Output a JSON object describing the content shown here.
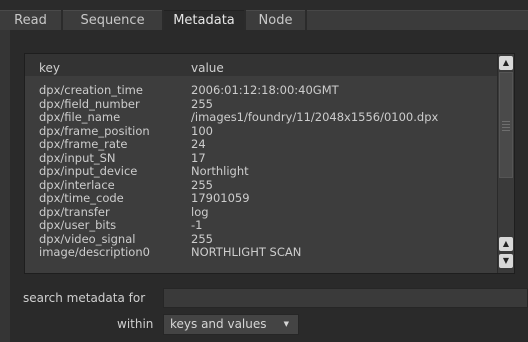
{
  "tabs": [
    {
      "label": "Read"
    },
    {
      "label": "Sequence"
    },
    {
      "label": "Metadata"
    },
    {
      "label": "Node"
    }
  ],
  "table": {
    "headers": {
      "key": "key",
      "value": "value"
    },
    "rows": [
      {
        "key": "dpx/creation_time",
        "value": "2006:01:12:18:00:40GMT"
      },
      {
        "key": "dpx/field_number",
        "value": "255"
      },
      {
        "key": "dpx/file_name",
        "value": "/images1/foundry/11/2048x1556/0100.dpx"
      },
      {
        "key": "dpx/frame_position",
        "value": "100"
      },
      {
        "key": "dpx/frame_rate",
        "value": "24"
      },
      {
        "key": "dpx/input_SN",
        "value": "17"
      },
      {
        "key": "dpx/input_device",
        "value": "Northlight"
      },
      {
        "key": "dpx/interlace",
        "value": "255"
      },
      {
        "key": "dpx/time_code",
        "value": "17901059"
      },
      {
        "key": "dpx/transfer",
        "value": "log"
      },
      {
        "key": "dpx/user_bits",
        "value": "-1"
      },
      {
        "key": "dpx/video_signal",
        "value": "255"
      },
      {
        "key": "image/description0",
        "value": "NORTHLIGHT SCAN"
      }
    ]
  },
  "search": {
    "label": "search metadata for",
    "value": ""
  },
  "within": {
    "label": "within",
    "selected": "keys and values"
  },
  "icons": {
    "scroll_up": "arrow-up-icon",
    "scroll_down": "arrow-down-icon",
    "dropdown": "chevron-down-icon"
  }
}
